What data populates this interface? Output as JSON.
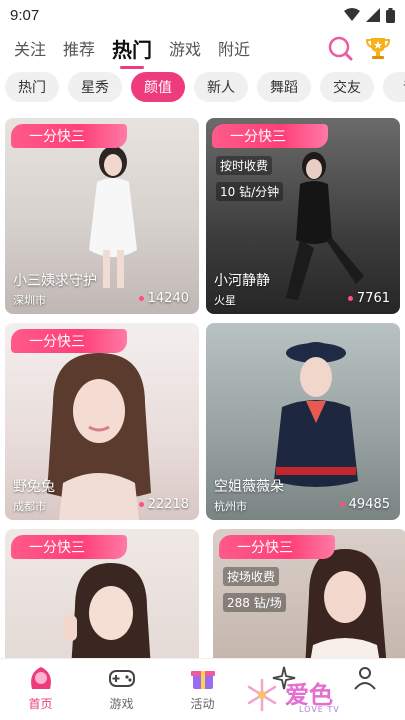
{
  "status": {
    "time": "9:07"
  },
  "top_tabs": [
    "关注",
    "推荐",
    "热门",
    "游戏",
    "附近"
  ],
  "chips": [
    "热门",
    "星秀",
    "颜值",
    "新人",
    "舞蹈",
    "交友",
    "音"
  ],
  "cards": [
    {
      "badge": "一分快三",
      "fee": "",
      "rate": "",
      "name": "小三姨求守护",
      "city": "深圳市",
      "count": "14240"
    },
    {
      "badge": "一分快三",
      "fee": "按时收费",
      "rate": "10 钻/分钟",
      "name": "小河静静",
      "city": "火星",
      "count": "7761"
    },
    {
      "badge": "一分快三",
      "fee": "",
      "rate": "",
      "name": "野兔兔",
      "city": "成都市",
      "count": "22218"
    },
    {
      "badge": "",
      "fee": "",
      "rate": "",
      "name": "空姐薇薇朵",
      "city": "杭州市",
      "count": "49485"
    },
    {
      "badge": "一分快三",
      "fee": "",
      "rate": "",
      "name": "",
      "city": "",
      "count": ""
    },
    {
      "badge": "一分快三",
      "fee": "按场收费",
      "rate": "288 钻/场",
      "name": "",
      "city": "",
      "count": ""
    }
  ],
  "bottom_nav": [
    "首页",
    "游戏",
    "活动",
    "",
    ""
  ],
  "watermark": {
    "text": "爱色",
    "sub": "LOVE TV"
  },
  "colors": {
    "accent": "#ee3b7c"
  }
}
